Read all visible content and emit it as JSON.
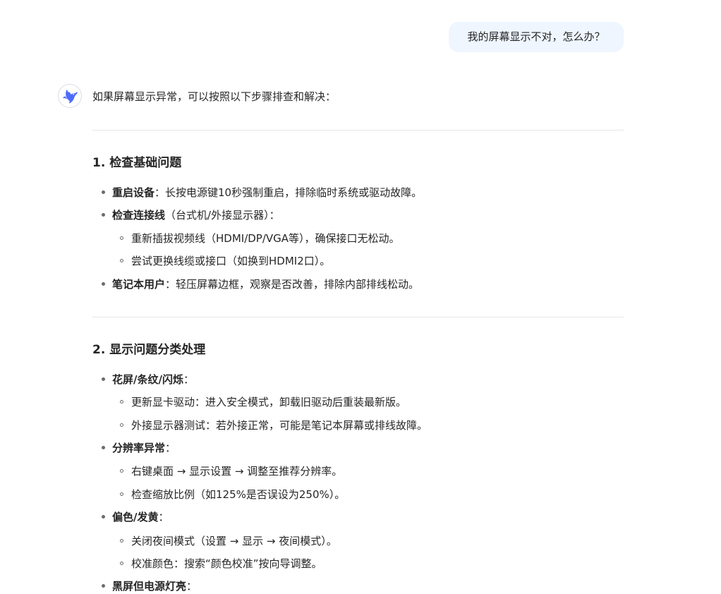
{
  "user_message": "我的屏幕显示不对，怎么办？",
  "assistant": {
    "avatar_icon": "whale-logo-icon",
    "intro": "如果屏幕显示异常，可以按照以下步骤排查和解决：",
    "sections": [
      {
        "title": "1. 检查基础问题",
        "items": [
          {
            "label": "重启设备",
            "text": "：长按电源键10秒强制重启，排除临时系统或驱动故障。"
          },
          {
            "label": "检查连接线",
            "text": "（台式机/外接显示器）：",
            "subitems": [
              "重新插拔视频线（HDMI/DP/VGA等），确保接口无松动。",
              "尝试更换线缆或接口（如换到HDMI2口）。"
            ]
          },
          {
            "label": "笔记本用户",
            "text": "：轻压屏幕边框，观察是否改善，排除内部排线松动。"
          }
        ]
      },
      {
        "title": "2. 显示问题分类处理",
        "items": [
          {
            "label": "花屏/条纹/闪烁",
            "text": "：",
            "subitems": [
              "更新显卡驱动：进入安全模式，卸载旧驱动后重装最新版。",
              "外接显示器测试：若外接正常，可能是笔记本屏幕或排线故障。"
            ]
          },
          {
            "label": "分辨率异常",
            "text": "：",
            "subitems": [
              "右键桌面 → 显示设置 → 调整至推荐分辨率。",
              "检查缩放比例（如125%是否误设为250%）。"
            ]
          },
          {
            "label": "偏色/发黄",
            "text": "：",
            "subitems": [
              "关闭夜间模式（设置 → 显示 → 夜间模式）。",
              "校准颜色：搜索“颜色校准”按向导调整。"
            ]
          },
          {
            "label": "黑屏但电源灯亮",
            "text": "："
          }
        ]
      }
    ]
  },
  "colors": {
    "user_bubble_bg": "#eff6ff",
    "text": "#262626",
    "divider": "#e6e6e6",
    "logo": "#4d6bfe"
  }
}
